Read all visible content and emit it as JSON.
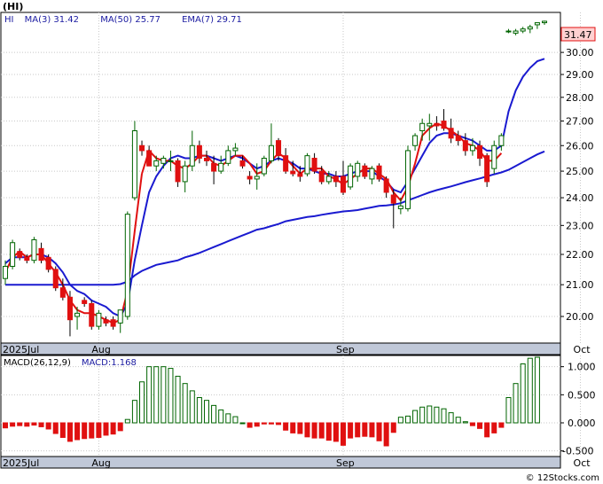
{
  "symbol": "(HI)",
  "copyright": "© 12Stocks.com",
  "price_legend": [
    {
      "label": "HI",
      "color": "#1a1aa0"
    },
    {
      "label": "MA(3)",
      "value": "31.42",
      "color": "#1a1aa0"
    },
    {
      "label": "MA(50)",
      "value": "25.77",
      "color": "#1a1aa0"
    },
    {
      "label": "EMA(7)",
      "value": "29.71",
      "color": "#1a1aa0"
    }
  ],
  "macd_legend": [
    {
      "label": "MACD(26,12,9)",
      "color": "#000000"
    },
    {
      "label": "MACD:1.168",
      "color": "#1a1aa0"
    }
  ],
  "last_price_label": "31.47",
  "colors": {
    "up": "#ffffff",
    "up_border": "#006400",
    "down": "#e01010",
    "ma_blue": "#1a1ad0",
    "ema_red": "#e01010",
    "grid": "#c8c8c8",
    "axis_strip": "#c0c8d8",
    "price_tag_bg": "#ffd0d0"
  },
  "chart_data": [
    {
      "type": "candlestick",
      "yticks": [
        "20.00",
        "21.00",
        "22.00",
        "23.00",
        "24.00",
        "25.00",
        "26.00",
        "27.00",
        "28.00",
        "29.00",
        "30.00"
      ],
      "ylim": [
        19.2,
        31.9
      ],
      "log_scale": true,
      "x_labels": [
        {
          "label": "2025Jul",
          "index": 0
        },
        {
          "label": "Aug",
          "index": 13
        },
        {
          "label": "Sep",
          "index": 47
        },
        {
          "label": "Oct",
          "index": 80
        }
      ],
      "candles": [
        [
          21.2,
          21.8,
          21.0,
          21.6
        ],
        [
          21.6,
          22.5,
          21.5,
          22.4
        ],
        [
          22.1,
          22.2,
          21.8,
          21.9
        ],
        [
          21.9,
          22.0,
          21.7,
          21.8
        ],
        [
          21.8,
          22.6,
          21.7,
          22.5
        ],
        [
          22.2,
          22.4,
          21.7,
          21.8
        ],
        [
          21.9,
          22.0,
          21.4,
          21.5
        ],
        [
          21.5,
          21.6,
          20.8,
          20.9
        ],
        [
          20.9,
          21.2,
          20.5,
          20.6
        ],
        [
          20.6,
          20.8,
          19.4,
          19.9
        ],
        [
          20.0,
          20.3,
          19.6,
          20.1
        ],
        [
          20.5,
          20.6,
          20.3,
          20.4
        ],
        [
          20.4,
          20.5,
          19.6,
          19.7
        ],
        [
          19.7,
          20.2,
          19.6,
          20.1
        ],
        [
          19.9,
          20.0,
          19.7,
          19.8
        ],
        [
          19.9,
          20.0,
          19.6,
          19.7
        ],
        [
          19.8,
          20.2,
          19.5,
          20.2
        ],
        [
          20.0,
          23.5,
          19.9,
          23.4
        ],
        [
          24.0,
          27.0,
          23.9,
          26.6
        ],
        [
          26.0,
          26.2,
          25.6,
          25.8
        ],
        [
          25.8,
          26.0,
          25.2,
          25.2
        ],
        [
          25.2,
          25.6,
          25.0,
          25.4
        ],
        [
          25.3,
          25.6,
          25.1,
          25.5
        ],
        [
          25.4,
          25.8,
          25.0,
          25.4
        ],
        [
          25.4,
          25.5,
          24.4,
          24.6
        ],
        [
          24.6,
          25.4,
          24.2,
          25.2
        ],
        [
          25.2,
          26.6,
          25.0,
          26.0
        ],
        [
          26.0,
          26.2,
          25.3,
          25.5
        ],
        [
          25.5,
          25.8,
          25.2,
          25.4
        ],
        [
          25.3,
          25.6,
          24.5,
          25.0
        ],
        [
          25.0,
          25.6,
          24.9,
          25.3
        ],
        [
          25.3,
          26.0,
          25.2,
          25.8
        ],
        [
          25.8,
          26.1,
          25.6,
          25.9
        ],
        [
          25.4,
          25.6,
          25.1,
          25.2
        ],
        [
          24.8,
          25.0,
          24.5,
          24.7
        ],
        [
          24.7,
          25.3,
          24.3,
          24.8
        ],
        [
          24.9,
          25.6,
          24.8,
          25.5
        ],
        [
          25.4,
          26.9,
          25.3,
          26.0
        ],
        [
          26.2,
          26.3,
          25.4,
          25.6
        ],
        [
          25.6,
          25.9,
          24.9,
          25.0
        ],
        [
          25.0,
          25.4,
          24.8,
          24.9
        ],
        [
          24.9,
          25.2,
          24.6,
          24.8
        ],
        [
          24.9,
          25.7,
          24.8,
          25.6
        ],
        [
          25.5,
          25.7,
          24.9,
          25.0
        ],
        [
          25.0,
          25.2,
          24.5,
          24.6
        ],
        [
          24.6,
          25.0,
          24.5,
          24.8
        ],
        [
          24.8,
          25.0,
          24.4,
          24.6
        ],
        [
          24.8,
          25.4,
          24.1,
          24.2
        ],
        [
          24.4,
          25.3,
          24.3,
          25.2
        ],
        [
          24.8,
          25.4,
          24.6,
          25.3
        ],
        [
          25.2,
          25.3,
          24.7,
          24.8
        ],
        [
          24.7,
          25.2,
          24.5,
          25.1
        ],
        [
          25.2,
          25.3,
          24.6,
          24.7
        ],
        [
          24.7,
          24.8,
          24.0,
          24.2
        ],
        [
          24.1,
          24.3,
          22.9,
          23.8
        ],
        [
          23.6,
          24.0,
          23.4,
          23.7
        ],
        [
          23.6,
          26.0,
          23.5,
          25.8
        ],
        [
          26.0,
          26.5,
          25.8,
          26.4
        ],
        [
          26.6,
          27.1,
          26.2,
          26.9
        ],
        [
          26.8,
          27.3,
          26.2,
          26.9
        ],
        [
          26.9,
          27.2,
          26.6,
          26.8
        ],
        [
          27.0,
          27.5,
          26.6,
          26.7
        ],
        [
          26.7,
          27.1,
          26.1,
          26.3
        ],
        [
          26.4,
          26.6,
          26.0,
          26.2
        ],
        [
          26.2,
          26.5,
          25.6,
          25.8
        ],
        [
          25.8,
          26.3,
          25.6,
          26.0
        ],
        [
          26.0,
          26.2,
          25.2,
          25.5
        ],
        [
          25.6,
          25.7,
          24.4,
          24.6
        ],
        [
          25.1,
          26.2,
          24.9,
          26.0
        ],
        [
          26.0,
          26.5,
          25.8,
          26.4
        ],
        [
          31.0,
          31.1,
          30.9,
          31.0
        ],
        [
          30.9,
          31.1,
          30.8,
          31.0
        ],
        [
          31.0,
          31.2,
          30.9,
          31.1
        ],
        [
          31.1,
          31.3,
          30.9,
          31.2
        ],
        [
          31.3,
          31.4,
          31.1,
          31.4
        ],
        [
          31.4,
          31.5,
          31.3,
          31.47
        ]
      ],
      "ema7": [
        21.7,
        21.9,
        21.9,
        21.9,
        22.0,
        22.0,
        21.9,
        21.7,
        21.4,
        21.0,
        20.8,
        20.7,
        20.5,
        20.4,
        20.3,
        20.1,
        20.0,
        20.4,
        21.8,
        23.0,
        24.2,
        24.8,
        25.2,
        25.5,
        25.6,
        25.5,
        25.5,
        25.6,
        25.6,
        25.5,
        25.4,
        25.5,
        25.6,
        25.5,
        25.3,
        25.1,
        25.2,
        25.4,
        25.5,
        25.4,
        25.3,
        25.1,
        25.1,
        25.0,
        24.9,
        24.9,
        24.8,
        24.8,
        24.9,
        25.0,
        25.0,
        25.0,
        24.8,
        24.6,
        24.3,
        24.2,
        24.6,
        25.1,
        25.6,
        26.1,
        26.4,
        26.5,
        26.5,
        26.4,
        26.3,
        26.2,
        26.0,
        25.8,
        25.8,
        26.0,
        27.4,
        28.3,
        28.9,
        29.3,
        29.6,
        29.71
      ],
      "ma3": [
        21.4,
        21.9,
        22.1,
        21.9,
        22.0,
        22.0,
        21.7,
        21.4,
        21.0,
        20.5,
        20.2,
        20.1,
        20.1,
        20.0,
        19.9,
        19.8,
        19.9,
        20.8,
        22.8,
        24.9,
        25.8,
        25.5,
        25.4,
        25.4,
        25.2,
        25.1,
        25.3,
        25.6,
        25.6,
        25.3,
        25.2,
        25.4,
        25.6,
        25.6,
        25.3,
        24.9,
        25.0,
        25.4,
        25.7,
        25.5,
        25.2,
        24.9,
        25.1,
        25.1,
        25.1,
        24.8,
        24.7,
        24.5,
        24.7,
        24.9,
        25.1,
        25.1,
        24.9,
        24.7,
        24.2,
        23.9,
        24.4,
        25.3,
        26.4,
        26.7,
        26.9,
        26.8,
        26.6,
        26.4,
        26.1,
        26.0,
        25.8,
        25.4,
        25.4,
        25.7,
        27.5,
        29.4,
        31.0,
        31.1,
        31.2,
        31.42
      ],
      "ma50": [
        21.0,
        21.0,
        21.0,
        21.0,
        21.0,
        21.0,
        21.0,
        21.0,
        21.0,
        21.0,
        21.0,
        21.0,
        21.0,
        21.0,
        21.0,
        21.0,
        21.02,
        21.1,
        21.3,
        21.45,
        21.55,
        21.65,
        21.7,
        21.75,
        21.8,
        21.9,
        21.97,
        22.05,
        22.15,
        22.25,
        22.35,
        22.45,
        22.55,
        22.65,
        22.75,
        22.85,
        22.9,
        22.98,
        23.05,
        23.15,
        23.2,
        23.25,
        23.3,
        23.33,
        23.38,
        23.42,
        23.46,
        23.5,
        23.52,
        23.55,
        23.6,
        23.65,
        23.7,
        23.72,
        23.75,
        23.8,
        23.9,
        24.0,
        24.1,
        24.2,
        24.28,
        24.35,
        24.42,
        24.5,
        24.58,
        24.65,
        24.72,
        24.8,
        24.88,
        24.95,
        25.05,
        25.2,
        25.35,
        25.5,
        25.65,
        25.77
      ]
    },
    {
      "type": "bar",
      "name": "MACD histogram",
      "yticks": [
        "-0.500",
        "0.000",
        "0.500",
        "1.000"
      ],
      "ylim": [
        -0.6,
        1.2
      ],
      "x_labels": [
        {
          "label": "2025Jul",
          "index": 0
        },
        {
          "label": "Aug",
          "index": 13
        },
        {
          "label": "Sep",
          "index": 47
        },
        {
          "label": "Oct",
          "index": 80
        }
      ],
      "values": [
        -0.09,
        -0.06,
        -0.05,
        -0.06,
        -0.04,
        -0.07,
        -0.11,
        -0.19,
        -0.26,
        -0.33,
        -0.3,
        -0.28,
        -0.27,
        -0.26,
        -0.22,
        -0.2,
        -0.14,
        0.06,
        0.4,
        0.73,
        1.0,
        1.0,
        1.0,
        0.97,
        0.83,
        0.7,
        0.57,
        0.45,
        0.4,
        0.31,
        0.23,
        0.16,
        0.11,
        0.0,
        -0.08,
        -0.06,
        -0.02,
        -0.02,
        -0.03,
        -0.13,
        -0.18,
        -0.19,
        -0.25,
        -0.27,
        -0.27,
        -0.31,
        -0.33,
        -0.4,
        -0.27,
        -0.25,
        -0.24,
        -0.25,
        -0.32,
        -0.41,
        -0.17,
        0.1,
        0.12,
        0.22,
        0.28,
        0.3,
        0.28,
        0.25,
        0.18,
        0.1,
        0.02,
        -0.05,
        -0.1,
        -0.25,
        -0.18,
        -0.08,
        0.45,
        0.7,
        1.05,
        1.15,
        1.168
      ]
    }
  ]
}
